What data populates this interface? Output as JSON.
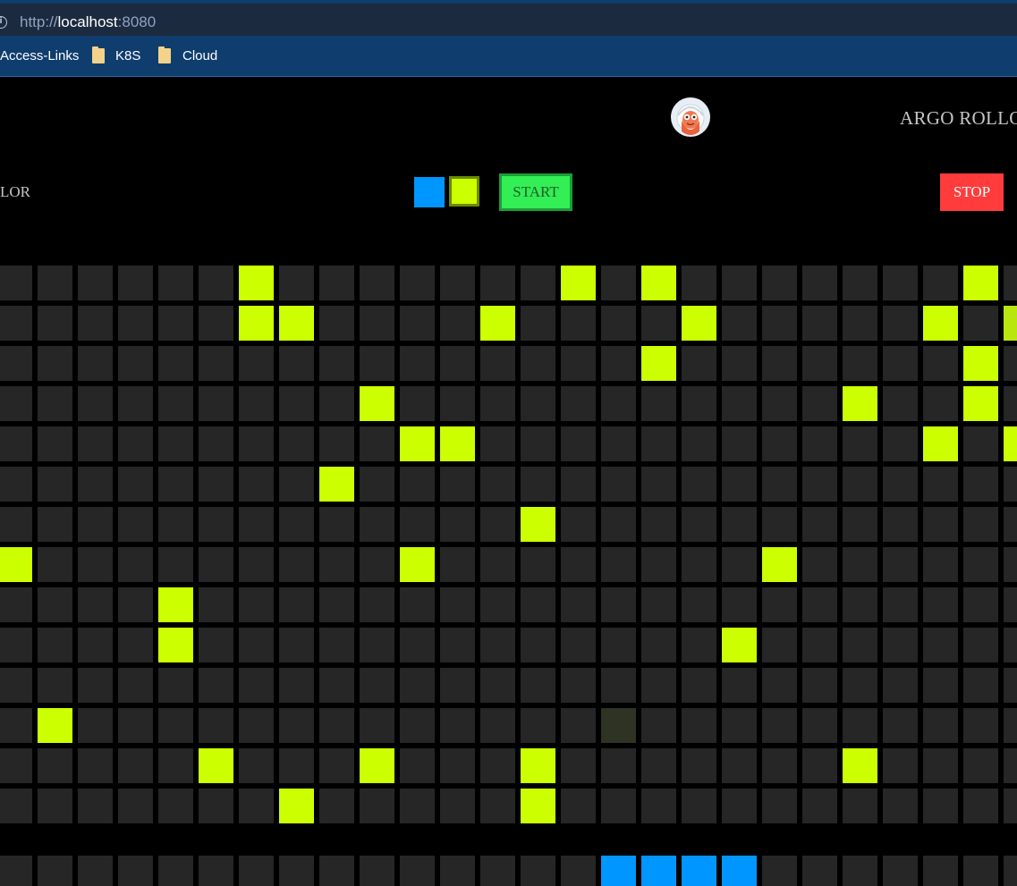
{
  "browser": {
    "url_protocol": "http://",
    "url_host": "localhost",
    "url_port": ":8080",
    "bookmarks": [
      "Access-Links",
      "K8S",
      "Cloud"
    ]
  },
  "header": {
    "title": "ARGO ROLLO",
    "logo_icon": "argo-mascot-icon"
  },
  "controls": {
    "color_label": "LOR",
    "color_options": [
      "#0096ff",
      "#ccff00"
    ],
    "selected_color": "#ccff00",
    "start_label": "START",
    "stop_label": "STOP"
  },
  "grid": {
    "columns": 26,
    "rows": 14,
    "cells": [
      "000000100000001010000000101",
      "000000110000100001000001020",
      "000000000000000010000000100",
      "000000000100000000000100100",
      "000000000011000000000001011",
      "000000001000000000000000000",
      "000000000000010000000000001",
      "100000000010000000010000000",
      "000010000000000000000000000",
      "000010000000000000100000000",
      "000000000000000000000000001",
      "010000000000000300000000001",
      "000001000100010000000100000",
      "000000010000010000000000001"
    ]
  },
  "bottom_row": {
    "cells": "000000000000000444400000000"
  },
  "colors": {
    "lit": "#ccff00",
    "dim": "#b8e60e",
    "faint": "#2e3323",
    "empty": "#262626",
    "blue": "#0096ff"
  }
}
